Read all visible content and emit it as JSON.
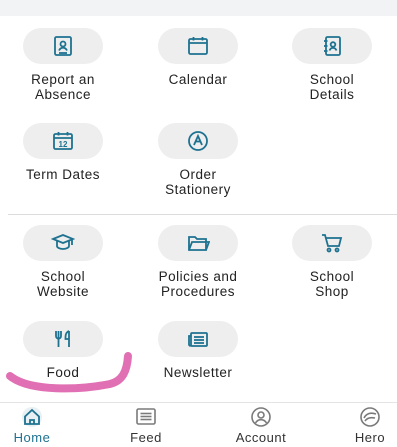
{
  "colors": {
    "accent": "#1e7290",
    "icon_bg": "#eeeeee",
    "annotation": "#e070b3"
  },
  "section1": [
    {
      "label": "Report an\nAbsence",
      "icon": "id-card-icon"
    },
    {
      "label": "Calendar",
      "icon": "calendar-icon"
    },
    {
      "label": "School\nDetails",
      "icon": "address-book-icon"
    },
    {
      "label": "Term Dates",
      "icon": "calendar-12-icon"
    },
    {
      "label": "Order\nStationery",
      "icon": "stationery-icon"
    }
  ],
  "section2": [
    {
      "label": "School\nWebsite",
      "icon": "graduation-cap-icon"
    },
    {
      "label": "Policies and\nProcedures",
      "icon": "folder-icon"
    },
    {
      "label": "School\nShop",
      "icon": "shopping-cart-icon"
    },
    {
      "label": "Food",
      "icon": "cutlery-icon"
    },
    {
      "label": "Newsletter",
      "icon": "newsletter-icon"
    }
  ],
  "tabs": [
    {
      "label": "Home",
      "icon": "home-icon",
      "active": true
    },
    {
      "label": "Feed",
      "icon": "feed-icon",
      "active": false
    },
    {
      "label": "Account",
      "icon": "account-icon",
      "active": false
    },
    {
      "label": "Hero",
      "icon": "hero-icon",
      "active": false
    }
  ]
}
